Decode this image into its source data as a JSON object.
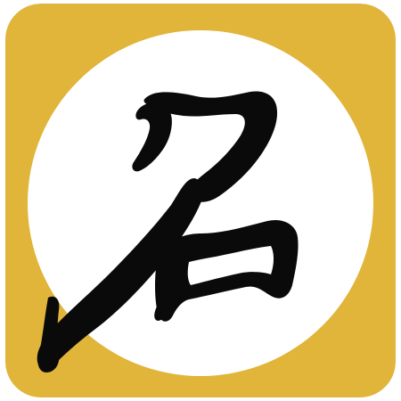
{
  "icon": {
    "name": "calligraphy-app-icon",
    "glyph": "名",
    "colors": {
      "background": "#E1B43A",
      "circle": "#FFFFFF",
      "ink": "#0A0A0A"
    }
  }
}
